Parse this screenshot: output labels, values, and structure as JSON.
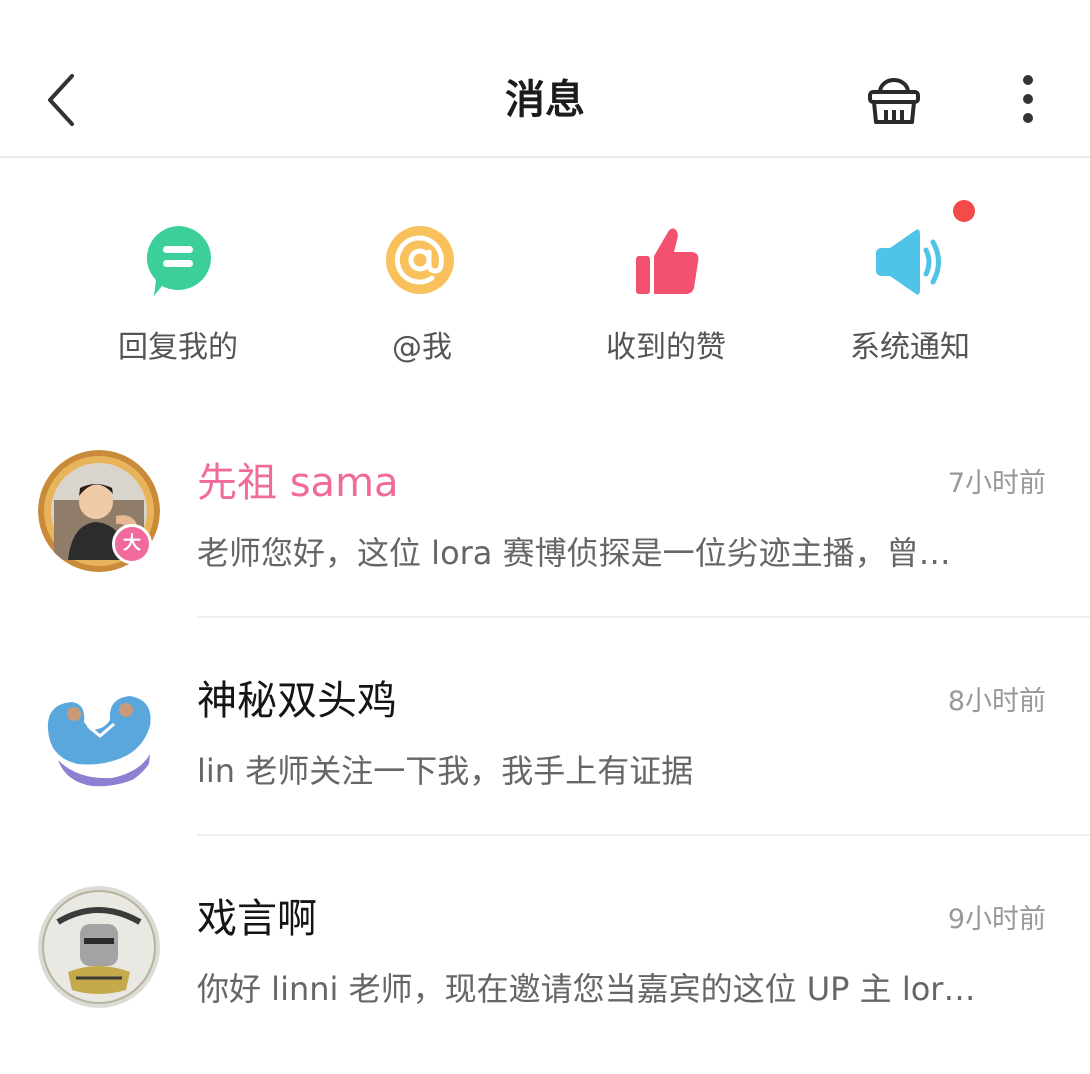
{
  "header": {
    "title": "消息",
    "icons": [
      "back-icon",
      "basket-icon",
      "more-vertical-icon"
    ]
  },
  "quick_actions": [
    {
      "label": "回复我的",
      "icon": "reply-bubble-icon",
      "color": "#3ccf9a"
    },
    {
      "label": "@我",
      "icon": "at-icon",
      "color": "#f8c15b"
    },
    {
      "label": "收到的赞",
      "icon": "thumbs-up-icon",
      "color": "#f2516f"
    },
    {
      "label": "系统通知",
      "icon": "speaker-icon",
      "color": "#4fc3e8",
      "has_unread_dot": true
    }
  ],
  "messages": [
    {
      "name": "先祖 sama",
      "time": "7小时前",
      "preview": "老师您好，这位 lora 赛博侦探是一位劣迹主播，曾…",
      "vip": true,
      "badge": "大"
    },
    {
      "name": "神秘双头鸡",
      "time": "8小时前",
      "preview": "lin 老师关注一下我，我手上有证据",
      "vip": false
    },
    {
      "name": "戏言啊",
      "time": "9小时前",
      "preview": "你好 linni 老师，现在邀请您当嘉宾的这位 UP 主 lor…",
      "vip": false
    }
  ],
  "colors": {
    "vip_name": "#f06b9c",
    "unread_dot": "#f44a4a",
    "time_text": "#999999",
    "preview_text": "#666666"
  }
}
